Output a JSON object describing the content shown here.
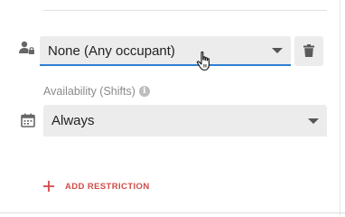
{
  "occupant": {
    "value": "None (Any occupant)",
    "icon": "person-lock-icon",
    "caret_icon": "caret-down-icon",
    "delete_icon": "trash-icon"
  },
  "availability": {
    "label": "Availability (Shifts)",
    "info_icon_glyph": "i",
    "value": "Always",
    "icon": "calendar-icon",
    "caret_icon": "caret-down-icon"
  },
  "add_restriction": {
    "label": "ADD RESTRICTION",
    "icon": "plus-icon"
  },
  "colors": {
    "accent_underline": "#2f7fd3",
    "action_red": "#d04a47",
    "field_bg": "#ececec"
  }
}
